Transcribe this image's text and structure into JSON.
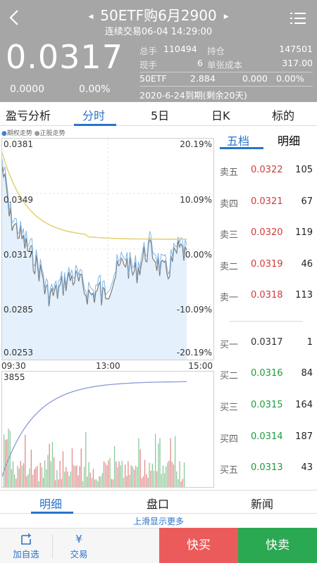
{
  "header": {
    "title": "50ETF购6月2900",
    "subtitle": "连续交易06-04  14:29:00",
    "price": "0.0317",
    "change": "0.0000",
    "change_pct": "0.00%",
    "stats": [
      {
        "k1": "总手",
        "v1": "110494",
        "k2": "持仓",
        "v2": "147501"
      },
      {
        "k1": "现手",
        "v1": "6",
        "k2": "单张成本",
        "v2": "317.00"
      }
    ],
    "etf": {
      "label": "50ETF",
      "price": "2.884",
      "change": "0.000",
      "pct": "0.00%"
    },
    "expire": "2020-6-24到期(剩余20天)"
  },
  "tabs": [
    "盈亏分析",
    "分时",
    "5日",
    "日K",
    "标的"
  ],
  "active_tab": 1,
  "chart": {
    "legend_option": "期权走势",
    "legend_stock": "正股走势",
    "y_left": [
      "0.0381",
      "0.0349",
      "0.0317",
      "0.0285",
      "0.0253"
    ],
    "y_right": [
      "20.19%",
      "10.09%",
      "0.00%",
      "-10.09%",
      "-20.19%"
    ],
    "times": [
      "09:30",
      "13:00",
      "15:00"
    ],
    "vol_max": "3855"
  },
  "orderbook": {
    "tabs": [
      "五档",
      "明细"
    ],
    "sell": [
      {
        "label": "卖五",
        "price": "0.0322",
        "qty": "105"
      },
      {
        "label": "卖四",
        "price": "0.0321",
        "qty": "67"
      },
      {
        "label": "卖三",
        "price": "0.0320",
        "qty": "119"
      },
      {
        "label": "卖二",
        "price": "0.0319",
        "qty": "46"
      },
      {
        "label": "卖一",
        "price": "0.0318",
        "qty": "113"
      }
    ],
    "buy": [
      {
        "label": "买一",
        "price": "0.0317",
        "qty": "1"
      },
      {
        "label": "买二",
        "price": "0.0316",
        "qty": "84"
      },
      {
        "label": "买三",
        "price": "0.0315",
        "qty": "164"
      },
      {
        "label": "买四",
        "price": "0.0314",
        "qty": "187"
      },
      {
        "label": "买五",
        "price": "0.0313",
        "qty": "43"
      }
    ]
  },
  "bottom_tabs": [
    "明细",
    "盘口",
    "新闻"
  ],
  "slide_hint": "上滑显示更多",
  "footer": {
    "watch": "加自选",
    "trade": "交易",
    "buy": "快买",
    "sell": "快卖"
  },
  "colors": {
    "accent": "#2a73c9",
    "up": "#d23a3a",
    "down": "#1f9c3c"
  }
}
